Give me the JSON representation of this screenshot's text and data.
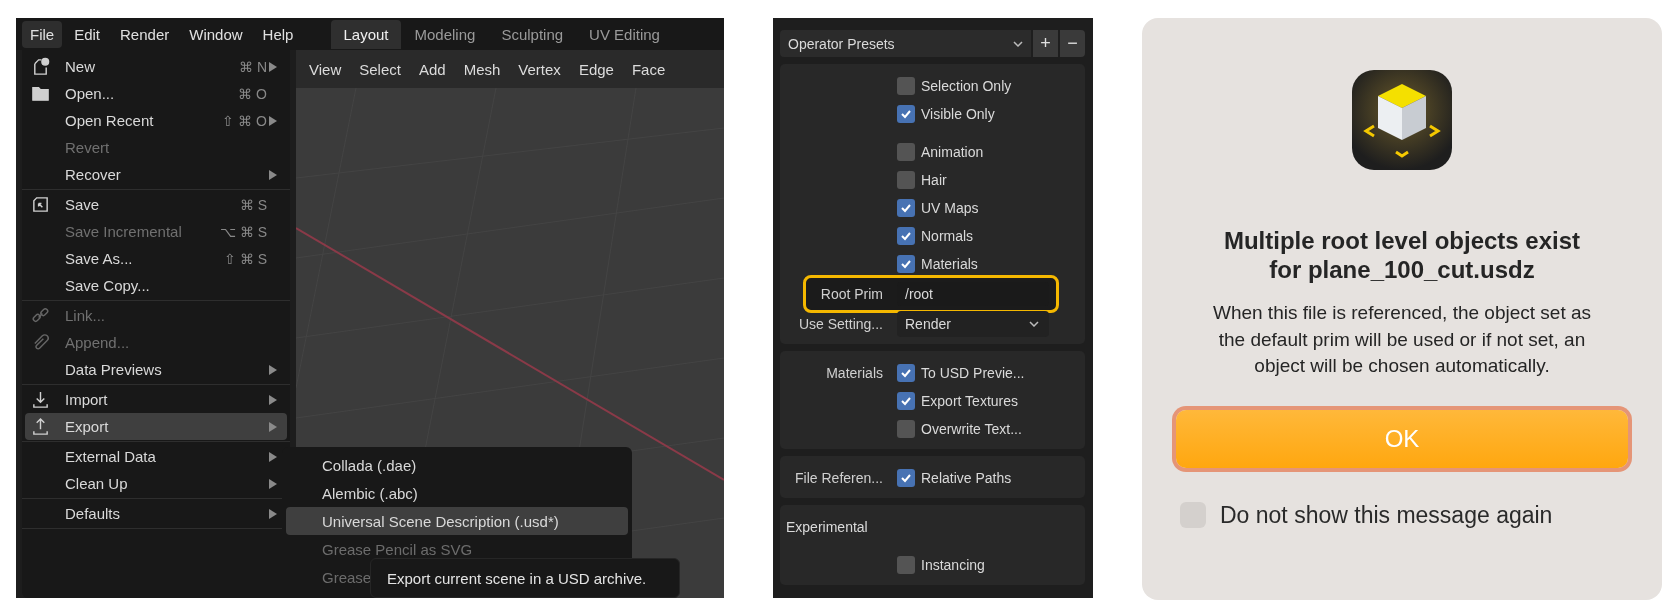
{
  "blender": {
    "menubar": [
      {
        "label": "File",
        "selected": true
      },
      {
        "label": "Edit",
        "selected": false
      },
      {
        "label": "Render",
        "selected": false
      },
      {
        "label": "Window",
        "selected": false
      },
      {
        "label": "Help",
        "selected": false
      }
    ],
    "workspaces": [
      {
        "label": "Layout",
        "selected": true
      },
      {
        "label": "Modeling",
        "selected": false
      },
      {
        "label": "Sculpting",
        "selected": false
      },
      {
        "label": "UV Editing",
        "selected": false
      }
    ],
    "viewport_header": [
      "View",
      "Select",
      "Add",
      "Mesh",
      "Vertex",
      "Edge",
      "Face"
    ],
    "file_menu": {
      "groups": [
        {
          "items": [
            {
              "label": "New",
              "kind": "new",
              "shortcut": "⌘ N",
              "submenu": true,
              "disabled": false,
              "selected": false
            },
            {
              "label": "Open...",
              "kind": "folder",
              "shortcut": "⌘ O",
              "submenu": false,
              "disabled": false,
              "selected": false
            },
            {
              "label": "Open Recent",
              "shortcut": "⇧ ⌘ O",
              "submenu": true,
              "disabled": false,
              "selected": false
            },
            {
              "label": "Revert",
              "submenu": false,
              "disabled": true,
              "selected": false
            },
            {
              "label": "Recover",
              "submenu": true,
              "disabled": false,
              "selected": false
            }
          ]
        },
        {
          "items": [
            {
              "label": "Save",
              "kind": "save",
              "shortcut": "⌘ S",
              "submenu": false,
              "disabled": false,
              "selected": false
            },
            {
              "label": "Save Incremental",
              "shortcut": "⌥ ⌘ S",
              "submenu": false,
              "disabled": true,
              "selected": false
            },
            {
              "label": "Save As...",
              "shortcut": "⇧ ⌘ S",
              "submenu": false,
              "disabled": false,
              "selected": false
            },
            {
              "label": "Save Copy...",
              "submenu": false,
              "disabled": false,
              "selected": false
            }
          ]
        },
        {
          "items": [
            {
              "label": "Link...",
              "kind": "link",
              "submenu": false,
              "disabled": true,
              "selected": false
            },
            {
              "label": "Append...",
              "kind": "append",
              "submenu": false,
              "disabled": true,
              "selected": false
            },
            {
              "label": "Data Previews",
              "submenu": true,
              "disabled": false,
              "selected": false
            }
          ]
        },
        {
          "items": [
            {
              "label": "Import",
              "kind": "import",
              "submenu": true,
              "disabled": false,
              "selected": false
            },
            {
              "label": "Export",
              "kind": "export",
              "submenu": true,
              "disabled": false,
              "selected": true
            }
          ]
        },
        {
          "items": [
            {
              "label": "External Data",
              "submenu": true,
              "disabled": false,
              "selected": false
            },
            {
              "label": "Clean Up",
              "submenu": true,
              "disabled": false,
              "selected": false
            }
          ]
        },
        {
          "items": [
            {
              "label": "Defaults",
              "submenu": true,
              "disabled": false,
              "selected": false
            }
          ]
        }
      ]
    },
    "export_menu": [
      {
        "label": "Collada (.dae)",
        "selected": false,
        "disabled": false
      },
      {
        "label": "Alembic (.abc)",
        "selected": false,
        "disabled": false
      },
      {
        "label": "Universal Scene Description (.usd*)",
        "selected": true,
        "disabled": false
      },
      {
        "label": "Grease Pencil as SVG",
        "selected": false,
        "disabled": true
      },
      {
        "label": "Grease",
        "selected": false,
        "disabled": true
      }
    ],
    "tooltip": "Export current scene in a USD archive."
  },
  "export_panel": {
    "presets": {
      "label": "Operator Presets",
      "add": "+",
      "remove": "−"
    },
    "sections": [
      {
        "groups": [
          [
            {
              "kind": "checkbox",
              "text": "Selection Only",
              "checked": false
            },
            {
              "kind": "checkbox",
              "text": "Visible Only",
              "checked": true
            }
          ],
          [
            {
              "kind": "checkbox",
              "text": "Animation",
              "checked": false
            },
            {
              "kind": "checkbox",
              "text": "Hair",
              "checked": false
            },
            {
              "kind": "checkbox",
              "text": "UV Maps",
              "checked": true
            },
            {
              "kind": "checkbox",
              "text": "Normals",
              "checked": true
            },
            {
              "kind": "checkbox",
              "text": "Materials",
              "checked": true
            },
            {
              "kind": "field",
              "label": "Root Prim",
              "value": "/root",
              "highlighted": true
            },
            {
              "kind": "dropdown",
              "label": "Use Setting...",
              "value": "Render"
            }
          ]
        ]
      },
      {
        "groups": [
          [
            {
              "kind": "checkbox",
              "label": "Materials",
              "text": "To USD Previe...",
              "checked": true
            },
            {
              "kind": "checkbox",
              "text": "Export Textures",
              "checked": true
            },
            {
              "kind": "checkbox",
              "text": "Overwrite Text...",
              "checked": false
            }
          ]
        ]
      },
      {
        "groups": [
          [
            {
              "kind": "checkbox",
              "label": "File Referen...",
              "text": "Relative Paths",
              "checked": true
            }
          ]
        ]
      },
      {
        "groups": [
          [
            {
              "kind": "heading",
              "text": "Experimental"
            }
          ],
          [
            {
              "kind": "checkbox",
              "text": "Instancing",
              "checked": false
            }
          ]
        ]
      }
    ]
  },
  "dialog": {
    "title": "Multiple root level objects exist for plane_100_cut.usdz",
    "message": "When this file is referenced, the object set as the default prim will be used or if not set, an object will be chosen automatically.",
    "button": {
      "label": "OK",
      "focused": true
    },
    "checkbox": {
      "label": "Do not show this message again",
      "checked": false
    }
  }
}
